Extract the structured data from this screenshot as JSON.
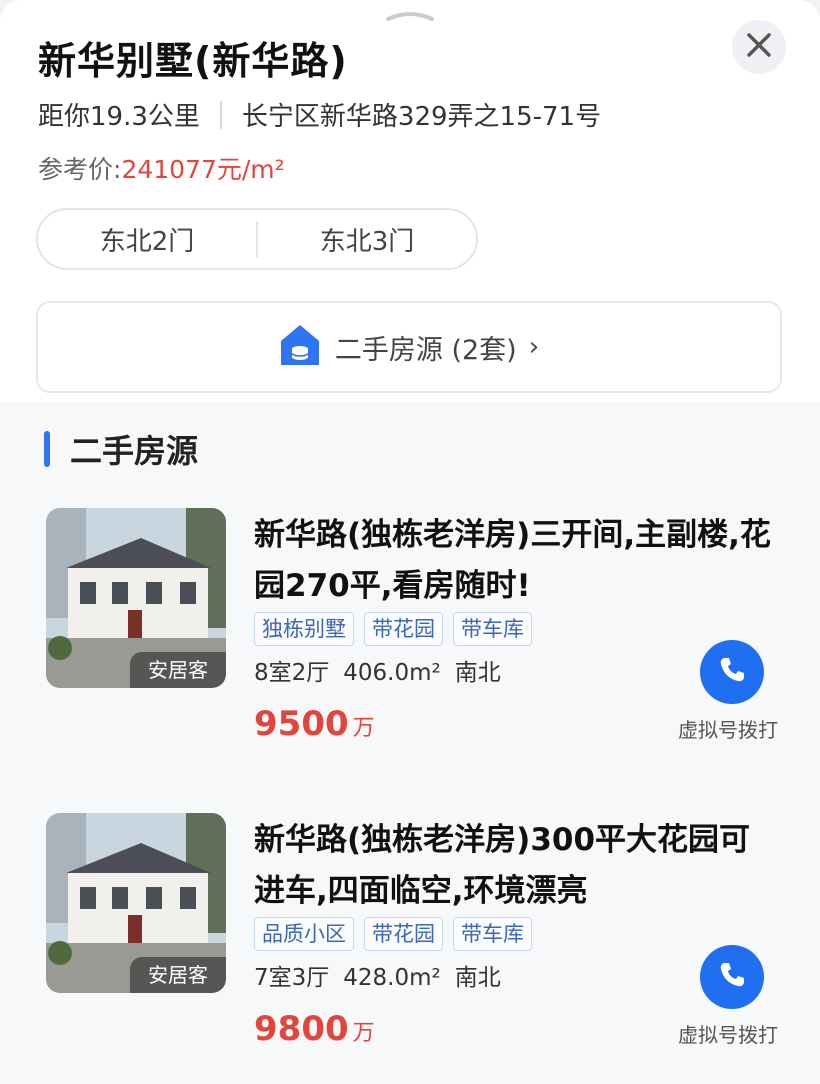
{
  "header": {
    "title": "新华别墅(新华路)",
    "distance": "距你19.3公里",
    "address": "长宁区新华路329弄之15-71号",
    "price_label": "参考价:",
    "price_value": "241077",
    "price_unit": "元/m²"
  },
  "gates": [
    "东北2门",
    "东北3门"
  ],
  "listing_button": {
    "label": "二手房源 (2套)",
    "chevron": "›",
    "icon": "house-stack-icon"
  },
  "section": {
    "title": "二手房源"
  },
  "listings": [
    {
      "title": "新华路(独栋老洋房)三开间,主副楼,花园270平,看房随时!",
      "badge": "安居客",
      "tags": [
        "独栋别墅",
        "带花园",
        "带车库"
      ],
      "rooms": "8室2厅",
      "area": "406.0m²",
      "orientation": "南北",
      "price": "9500",
      "price_unit": "万",
      "call_label": "虚拟号拨打"
    },
    {
      "title": "新华路(独栋老洋房)300平大花园可进车,四面临空,环境漂亮",
      "badge": "安居客",
      "tags": [
        "品质小区",
        "带花园",
        "带车库"
      ],
      "rooms": "7室3厅",
      "area": "428.0m²",
      "orientation": "南北",
      "price": "9800",
      "price_unit": "万",
      "call_label": "虚拟号拨打"
    }
  ],
  "colors": {
    "accent": "#2f74f0",
    "price": "#e2453b",
    "call": "#1f6ff0"
  }
}
